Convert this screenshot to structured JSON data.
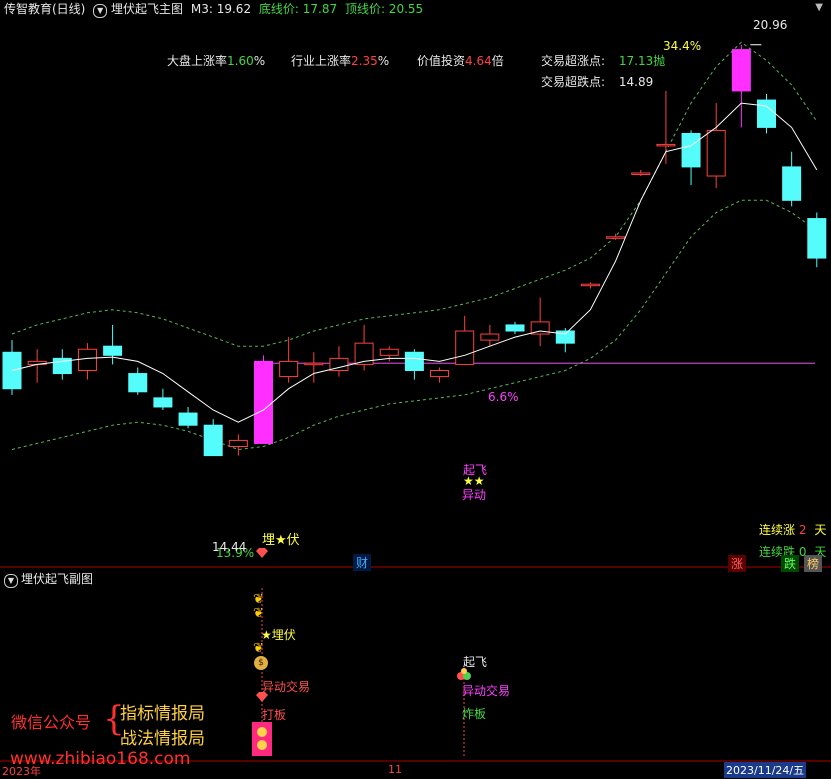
{
  "header": {
    "title": "传智教育(日线)",
    "indicator_name": "埋伏起飞主图",
    "m3_label": "M3: 19.62",
    "bottom_line_label": "底线价: 17.87",
    "top_line_label": "顶线价: 20.55"
  },
  "info_panel": {
    "market_rise_label": "大盘上涨率",
    "market_rise_value": "1.60",
    "market_rise_unit": "%",
    "industry_rise_label": "行业上涨率",
    "industry_rise_value": "2.35",
    "industry_rise_unit": "%",
    "value_invest_label": "价值投资",
    "value_invest_value": "4.64",
    "value_invest_unit": "倍",
    "overbought_label": "交易超涨点:",
    "overbought_value": "17.13",
    "overbought_suffix": "抛",
    "oversold_label": "交易超跌点:",
    "oversold_value": "14.89"
  },
  "annotations": {
    "high_pct": "34.4%",
    "high_price": "20.96",
    "mid_pct": "6.6%",
    "low_pct": "13.9%",
    "low_price": "14.44",
    "ambush_label": "埋★伏",
    "takeoff_label": "起飞",
    "stars": "★★",
    "abnormal_label": "异动",
    "finance_badge": "财",
    "consec_rise_label": "连续涨",
    "consec_rise_value": "2",
    "consec_rise_unit": "天",
    "consec_fall_label": "连续跌",
    "consec_fall_value": "0",
    "consec_fall_unit": "天",
    "tag_rise": "涨",
    "tag_fall": "跌",
    "tag_list": "榜"
  },
  "sub_chart": {
    "title": "埋伏起飞副图",
    "ambush": "★埋伏",
    "abnormal_trade_1": "异动交易",
    "bottom_board": "打板",
    "takeoff": "起飞",
    "abnormal_trade_2": "异动交易",
    "explode_board": "炸板",
    "wechat_label": "微信公众号",
    "brand_1": "指标情报局",
    "brand_2": "战法情报局",
    "website": "www.zhibiao168.com",
    "x_start": "2023年",
    "x_mid": "11",
    "x_end": "2023/11/24/五"
  },
  "chart_data": {
    "type": "candlestick",
    "price_range": [
      12.4,
      21.4
    ],
    "reference_line": 15.72,
    "candles": [
      {
        "o": 15.9,
        "h": 16.1,
        "l": 15.2,
        "c": 15.3
      },
      {
        "o": 15.7,
        "h": 15.95,
        "l": 15.4,
        "c": 15.75
      },
      {
        "o": 15.8,
        "h": 15.95,
        "l": 15.45,
        "c": 15.55
      },
      {
        "o": 15.6,
        "h": 16.05,
        "l": 15.45,
        "c": 15.95
      },
      {
        "o": 16.0,
        "h": 16.35,
        "l": 15.7,
        "c": 15.85
      },
      {
        "o": 15.55,
        "h": 15.65,
        "l": 15.2,
        "c": 15.25
      },
      {
        "o": 15.15,
        "h": 15.3,
        "l": 14.95,
        "c": 15.0
      },
      {
        "o": 14.9,
        "h": 15.0,
        "l": 14.65,
        "c": 14.7
      },
      {
        "o": 14.7,
        "h": 14.8,
        "l": 14.2,
        "c": 14.2
      },
      {
        "o": 14.35,
        "h": 14.55,
        "l": 14.2,
        "c": 14.45
      },
      {
        "o": 14.4,
        "h": 15.85,
        "l": 14.4,
        "c": 15.75
      },
      {
        "o": 15.5,
        "h": 16.15,
        "l": 15.4,
        "c": 15.75
      },
      {
        "o": 15.7,
        "h": 15.9,
        "l": 15.4,
        "c": 15.72
      },
      {
        "o": 15.6,
        "h": 16.0,
        "l": 15.5,
        "c": 15.8
      },
      {
        "o": 15.7,
        "h": 16.35,
        "l": 15.6,
        "c": 16.05
      },
      {
        "o": 15.85,
        "h": 16.0,
        "l": 15.75,
        "c": 15.95
      },
      {
        "o": 15.9,
        "h": 15.95,
        "l": 15.45,
        "c": 15.6
      },
      {
        "o": 15.5,
        "h": 15.65,
        "l": 15.4,
        "c": 15.6
      },
      {
        "o": 15.7,
        "h": 16.5,
        "l": 15.7,
        "c": 16.25
      },
      {
        "o": 16.1,
        "h": 16.35,
        "l": 16.0,
        "c": 16.2
      },
      {
        "o": 16.35,
        "h": 16.4,
        "l": 16.2,
        "c": 16.25
      },
      {
        "o": 16.2,
        "h": 16.8,
        "l": 16.0,
        "c": 16.4
      },
      {
        "o": 16.25,
        "h": 16.3,
        "l": 15.9,
        "c": 16.05
      },
      {
        "o": 17.0,
        "h": 17.05,
        "l": 16.95,
        "c": 17.02
      },
      {
        "o": 17.8,
        "h": 17.85,
        "l": 17.75,
        "c": 17.8
      },
      {
        "o": 18.85,
        "h": 18.9,
        "l": 18.8,
        "c": 18.85
      },
      {
        "o": 19.3,
        "h": 20.2,
        "l": 19.0,
        "c": 19.32
      },
      {
        "o": 19.5,
        "h": 19.55,
        "l": 18.65,
        "c": 18.95
      },
      {
        "o": 18.8,
        "h": 20.0,
        "l": 18.6,
        "c": 19.55
      },
      {
        "o": 20.2,
        "h": 20.96,
        "l": 19.6,
        "c": 20.88
      },
      {
        "o": 20.05,
        "h": 20.15,
        "l": 19.5,
        "c": 19.6
      },
      {
        "o": 18.95,
        "h": 19.2,
        "l": 18.3,
        "c": 18.4
      },
      {
        "o": 18.1,
        "h": 18.2,
        "l": 17.3,
        "c": 17.45
      }
    ],
    "ma_line": [
      15.6,
      15.7,
      15.75,
      15.8,
      15.82,
      15.75,
      15.55,
      15.25,
      14.95,
      14.75,
      14.95,
      15.3,
      15.55,
      15.65,
      15.75,
      15.8,
      15.8,
      15.75,
      15.85,
      16.0,
      16.15,
      16.25,
      16.2,
      16.6,
      17.4,
      18.4,
      19.2,
      19.3,
      19.6,
      20.0,
      19.95,
      19.6,
      18.9
    ],
    "upper_band": [
      16.2,
      16.35,
      16.45,
      16.55,
      16.6,
      16.55,
      16.45,
      16.3,
      16.15,
      16.0,
      16.0,
      16.1,
      16.25,
      16.35,
      16.45,
      16.5,
      16.55,
      16.6,
      16.7,
      16.8,
      16.95,
      17.1,
      17.25,
      17.45,
      17.8,
      18.4,
      19.2,
      20.0,
      20.6,
      21.0,
      20.7,
      20.3,
      19.7
    ],
    "lower_band": [
      14.3,
      14.4,
      14.5,
      14.6,
      14.7,
      14.75,
      14.7,
      14.6,
      14.45,
      14.3,
      14.35,
      14.5,
      14.7,
      14.85,
      14.95,
      15.05,
      15.1,
      15.15,
      15.2,
      15.3,
      15.4,
      15.5,
      15.6,
      15.8,
      16.1,
      16.6,
      17.2,
      17.8,
      18.2,
      18.4,
      18.4,
      18.2,
      17.9
    ]
  }
}
